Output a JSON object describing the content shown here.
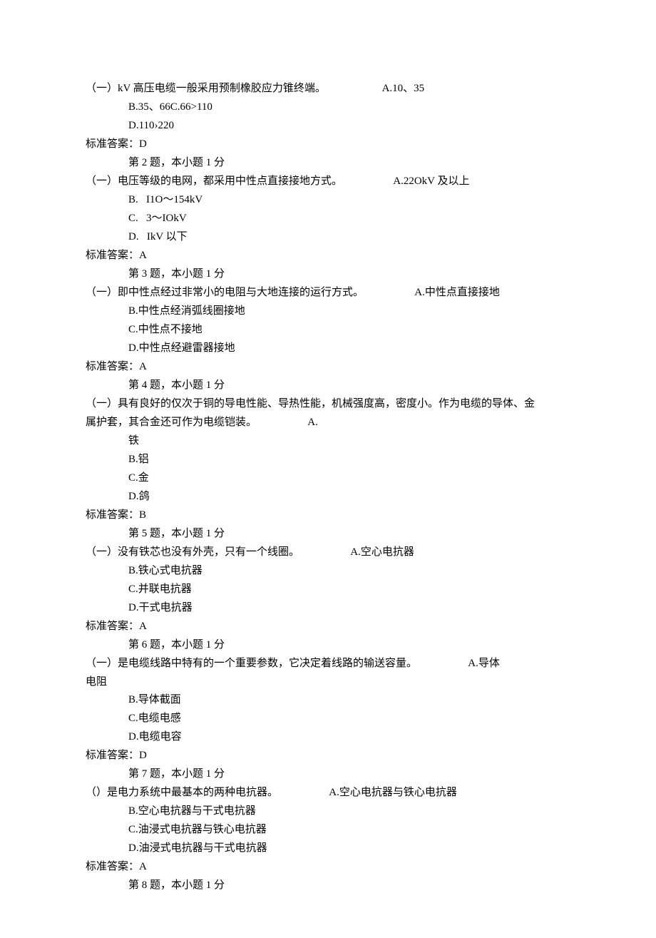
{
  "questions": [
    {
      "stem_prefix": "（一）kV 高压电缆一般采用预制橡胶应力锥终端。",
      "inline_opt": "A.10、35",
      "opts": [
        "B.35、66C.66>110",
        "D.110›220"
      ],
      "answer_label": "标准答案：D",
      "next_header": "第 2 题，本小题 1 分"
    },
    {
      "stem_prefix": "（一）电压等级的电网，都采用中性点直接接地方式。",
      "inline_opt": "A.22OkV 及以上",
      "opts": [
        "B.   I1O～154kV",
        "C.   3～IOkV",
        "D.   IkV 以下"
      ],
      "answer_label": "标准答案：A",
      "next_header": "第 3 题，本小题 1 分"
    },
    {
      "stem_prefix": "（一）即中性点经过非常小的电阻与大地连接的运行方式。",
      "inline_opt": "A.中性点直接接地",
      "opts": [
        "B.中性点经消弧线圈接地",
        "C.中性点不接地",
        "D.中性点经避雷器接地"
      ],
      "answer_label": "标准答案：A",
      "next_header": "第 4 题，本小题 1 分"
    },
    {
      "stem_line1": "（一）具有良好的仅次于铜的导电性能、导热性能，机械强度高，密度小。作为电缆的导体、金",
      "stem_line2_prefix": "属护套，其合金还可作为电缆铠装。",
      "stem_line2_inline": "A.",
      "post_line": "铁",
      "opts": [
        "B.铝",
        "C.金",
        "D.鸽"
      ],
      "answer_label": "标准答案：B",
      "next_header": "第 5 题，本小题 1 分"
    },
    {
      "stem_prefix": "（一）没有铁芯也没有外壳，只有一个线圈。",
      "inline_opt": "A.空心电抗器",
      "opts": [
        "B.铁心式电抗器",
        "C.并联电抗器",
        "D.干式电抗器"
      ],
      "answer_label": "标准答案：A",
      "next_header": "第 6 题，本小题 1 分"
    },
    {
      "stem_prefix": "（一）是电缆线路中特有的一个重要参数，它决定着线路的输送容量。",
      "inline_opt": "A.导体",
      "post_line": "电阻",
      "opts": [
        "B.导体截面",
        "C.电缆电感",
        "D.电缆电容"
      ],
      "answer_label": "标准答案：D",
      "next_header": "第 7 题，本小题 1 分"
    },
    {
      "stem_prefix": "（）是电力系统中最基本的两种电抗器。",
      "inline_opt": "A.空心电抗器与铁心电抗器",
      "opts": [
        "B.空心电抗器与干式电抗器",
        "C.油浸式电抗器与铁心电抗器",
        "D.油浸式电抗器与干式电抗器"
      ],
      "answer_label": "标准答案：A",
      "next_header": "第 8 题，本小题 1 分"
    }
  ]
}
